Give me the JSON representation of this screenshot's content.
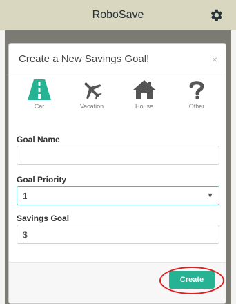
{
  "app": {
    "title": "RoboSave",
    "settings_icon": "gear-icon"
  },
  "modal": {
    "title": "Create a New Savings Goal!",
    "close_label": "×",
    "goal_types": [
      {
        "label": "Car",
        "icon": "road-icon",
        "color": "#26b394"
      },
      {
        "label": "Vacation",
        "icon": "airplane-icon",
        "color": "#555555"
      },
      {
        "label": "House",
        "icon": "house-icon",
        "color": "#555555"
      },
      {
        "label": "Other",
        "icon": "question-icon",
        "color": "#555555"
      }
    ],
    "fields": {
      "goal_name": {
        "label": "Goal Name",
        "value": "",
        "placeholder": ""
      },
      "goal_priority": {
        "label": "Goal Priority",
        "value": "1"
      },
      "savings_goal": {
        "label": "Savings Goal",
        "value": "",
        "placeholder": "$"
      }
    },
    "create_label": "Create"
  },
  "colors": {
    "accent": "#26b394",
    "appbar": "#d9d7c0",
    "highlight": "#e02020"
  }
}
